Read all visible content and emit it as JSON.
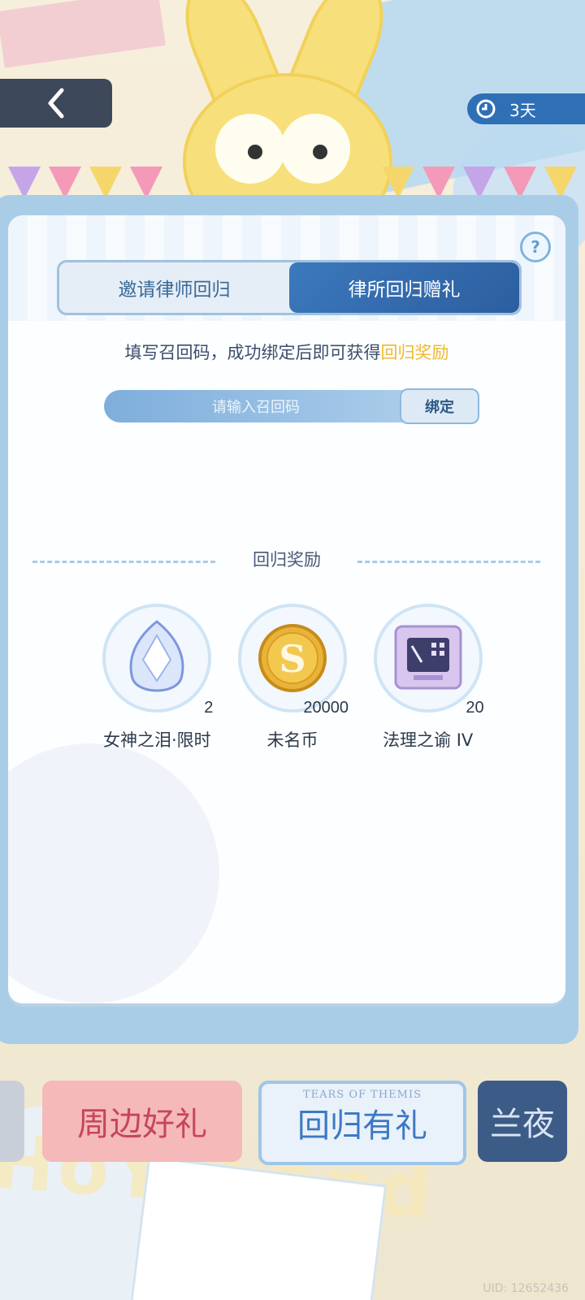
{
  "timer": {
    "label": "3天"
  },
  "tabs": [
    {
      "label": "邀请律师回归",
      "active": false
    },
    {
      "label": "律所回归赠礼",
      "active": true
    }
  ],
  "help": {
    "label": "?"
  },
  "description": {
    "text": "填写召回码，成功绑定后即可获得",
    "highlight": "回归奖励"
  },
  "code_input": {
    "placeholder": "请输入召回码",
    "value": ""
  },
  "bind_button": {
    "label": "绑定"
  },
  "rewards_section": {
    "title": "回归奖励",
    "items": [
      {
        "name": "女神之泪·限时",
        "quantity": "2",
        "icon": "crystal-tear-icon"
      },
      {
        "name": "未名币",
        "quantity": "20000",
        "icon": "gold-coin-icon"
      },
      {
        "name": "法理之谕 IV",
        "quantity": "20",
        "icon": "chip-card-icon"
      }
    ]
  },
  "carousel": [
    {
      "title": ""
    },
    {
      "title": "周边好礼"
    },
    {
      "title": "回归有礼",
      "subtitle": "TEARS OF THEMIS",
      "selected": true
    },
    {
      "title": "兰夜"
    }
  ],
  "background": {
    "logo_text": "HoYoLand"
  },
  "uid": {
    "text": "UID: 12652436"
  },
  "colors": {
    "accent": "#2f6fb6",
    "highlight": "#f1b92c",
    "text": "#2b3a4c"
  }
}
